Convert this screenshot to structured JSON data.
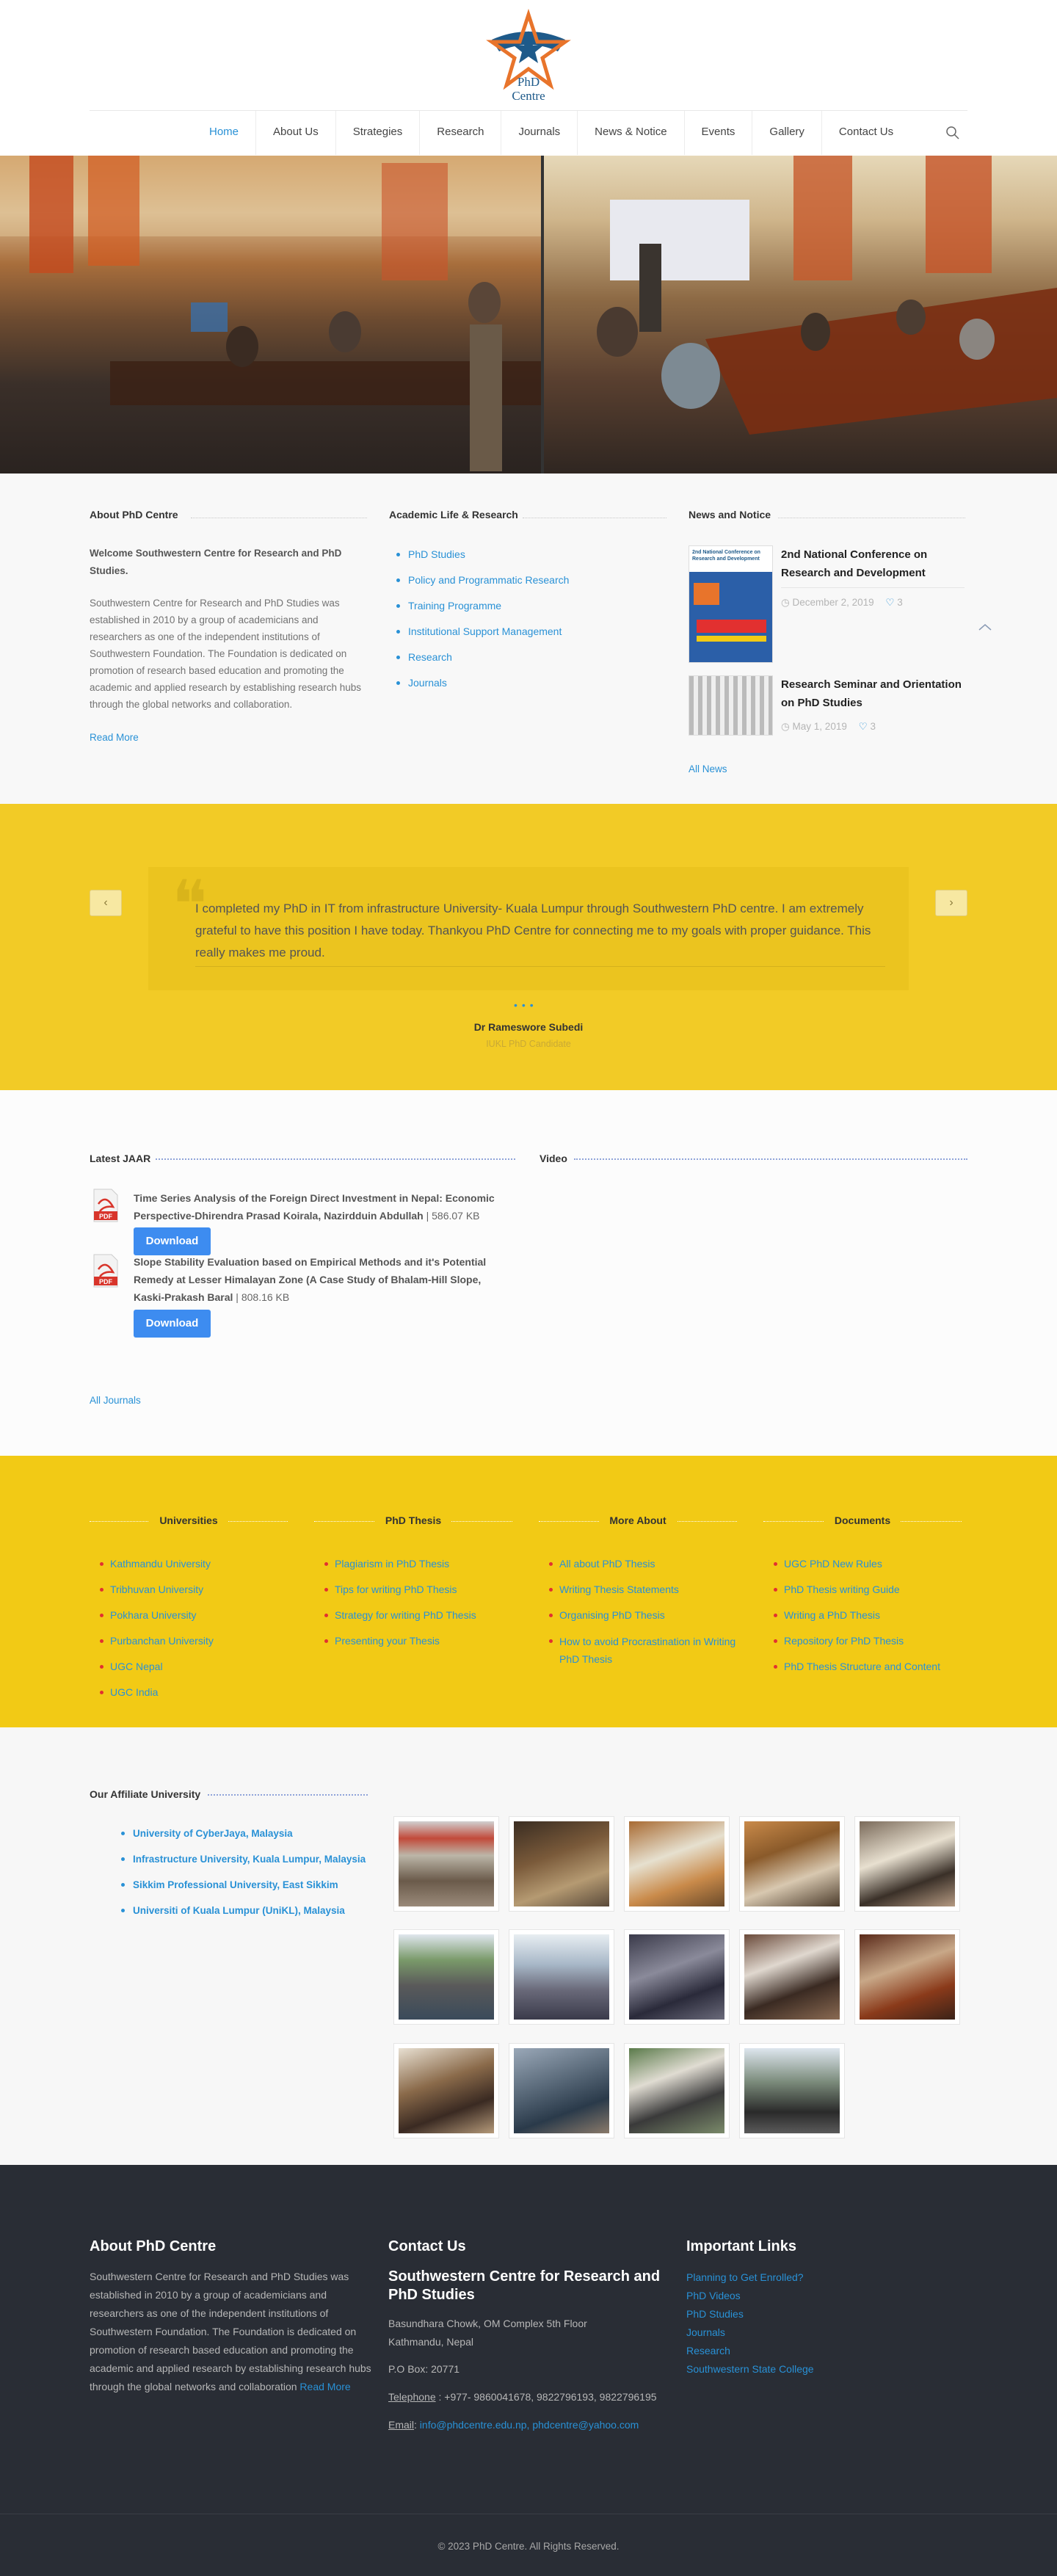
{
  "header": {
    "logo_text": "PhD Centre",
    "nav": [
      "Home",
      "About Us",
      "Strategies",
      "Research",
      "Journals",
      "News & Notice",
      "Events",
      "Gallery",
      "Contact Us"
    ]
  },
  "about": {
    "title": "About PhD Centre",
    "welcome": "Welcome Southwestern Centre for Research and PhD Studies.",
    "body": "Southwestern Centre for Research and PhD Studies was established in 2010 by a group of academicians and researchers as one of the independent institutions of Southwestern Foundation. The Foundation is dedicated on promotion of research based education and promoting the academic and applied research by establishing research hubs through the global networks and collaboration.",
    "read_more": "Read More"
  },
  "academic": {
    "title": "Academic Life & Research",
    "items": [
      "PhD Studies",
      "Policy and Programmatic Research",
      "Training Programme",
      "Institutional Support Management",
      "Research",
      "Journals"
    ]
  },
  "news": {
    "title": "News and Notice",
    "items": [
      {
        "title": "2nd National Conference on Research and Development",
        "date": "December 2, 2019",
        "likes": "3",
        "thumb_text": "2nd National Conference on Research and Development"
      },
      {
        "title": "Research Seminar and Orientation on PhD Studies",
        "date": "May 1, 2019",
        "likes": "3"
      }
    ],
    "all_news": "All News"
  },
  "testimonial": {
    "quote": "I completed my PhD in IT from infrastructure University- Kuala Lumpur through Southwestern PhD centre. I am extremely grateful to have this position I have today. Thankyou PhD Centre for connecting me to my goals with proper guidance. This really makes me proud.",
    "author": "Dr Rameswore Subedi",
    "role": "IUKL PhD Candidate",
    "prev": "‹",
    "next": "›"
  },
  "jaar": {
    "title": "Latest JAAR",
    "video_title": "Video",
    "docs": [
      {
        "title": "Time Series Analysis of the Foreign Direct Investment in Nepal: Economic Perspective-Dhirendra Prasad Koirala, Nazirdduin Abdullah",
        "size": " | 586.07 KB",
        "button": "Download"
      },
      {
        "title": "Slope Stability Evaluation based on Empirical Methods and it's Potential Remedy at Lesser Himalayan Zone (A Case Study of Bhalam-Hill Slope, Kaski-Prakash Baral",
        "size": " | 808.16 KB",
        "button": "Download"
      }
    ],
    "all_journals": "All Journals"
  },
  "links": {
    "columns": [
      {
        "title": "Universities",
        "items": [
          "Kathmandu University",
          "Tribhuvan University",
          "Pokhara University",
          "Purbanchan University",
          "UGC Nepal",
          "UGC India"
        ]
      },
      {
        "title": "PhD Thesis",
        "items": [
          "Plagiarism in PhD Thesis",
          "Tips for writing PhD Thesis",
          "Strategy for writing PhD Thesis",
          "Presenting your Thesis"
        ]
      },
      {
        "title": "More About",
        "items": [
          "All about PhD Thesis",
          "Writing Thesis Statements",
          "Organising PhD Thesis",
          "How to avoid Procrastination in Writing PhD Thesis"
        ]
      },
      {
        "title": "Documents",
        "items": [
          "UGC PhD New Rules",
          "PhD Thesis writing Guide",
          "Writing a PhD Thesis",
          "Repository for PhD Thesis",
          "PhD Thesis Structure and Content"
        ]
      }
    ]
  },
  "affiliates": {
    "title": "Our Affiliate University",
    "items": [
      "University of CyberJaya, Malaysia",
      "Infrastructure University, Kuala Lumpur, Malaysia",
      "Sikkim Professional University, East Sikkim",
      "Universiti of Kuala Lumpur (UniKL), Malaysia"
    ]
  },
  "footer": {
    "about_title": "About PhD Centre",
    "about_body": "Southwestern Centre for Research and PhD Studies was established in 2010 by a group of academicians and researchers as one of the independent institutions of Southwestern Foundation. The Foundation is dedicated on promotion of research based education and promoting the academic and applied research by establishing research hubs through the global networks and collaboration",
    "read_more": "Read More",
    "contact_title": "Contact Us",
    "org": "Southwestern Centre for Research and PhD Studies",
    "address1": "Basundhara Chowk, OM Complex 5th Floor",
    "address2": "Kathmandu, Nepal",
    "po_box": "P.O Box: 20771",
    "tel_label": "Telephone",
    "tel": " : +977- 9860041678, 9822796193, 9822796195",
    "email_label": "Email",
    "email": " info@phdcentre.edu.np, phdcentre@yahoo.com",
    "links_title": "Important Links",
    "links": [
      "Planning to Get Enrolled?",
      "PhD Videos",
      "PhD Studies",
      "Journals",
      "Research",
      "Southwestern State College"
    ],
    "copyright": "© 2023 PhD Centre. All Rights Reserved."
  },
  "colors": {
    "accent": "#2991d6",
    "yellow": "#f2ca15",
    "footer": "#292d35",
    "button": "#3d8cf0"
  }
}
